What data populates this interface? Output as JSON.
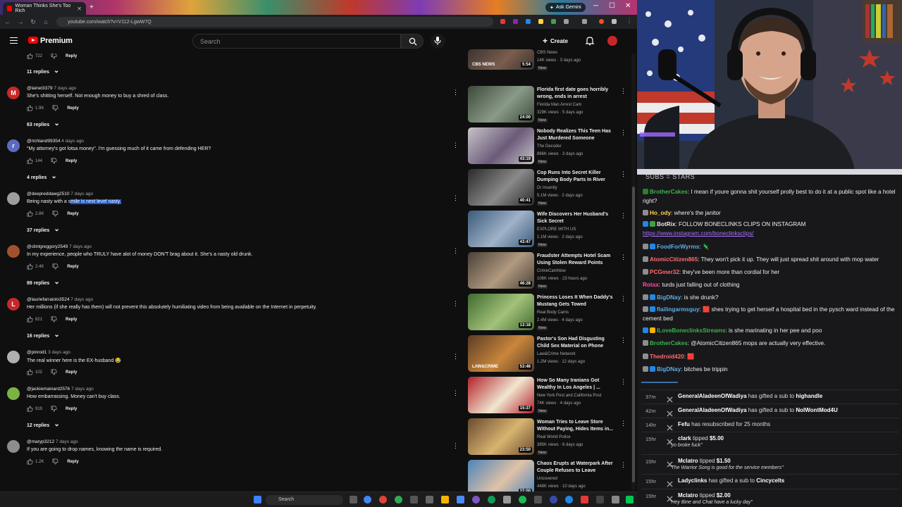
{
  "browser": {
    "tab_title": "Woman Thinks She's Too Rich",
    "gemini_label": "Ask Gemini",
    "url": "youtube.com/watch?v=V112-LgwW7Q"
  },
  "youtube": {
    "brand": "Premium",
    "search_placeholder": "Search",
    "create_label": "Create"
  },
  "comments": [
    {
      "type": "actions",
      "likes": "722"
    },
    {
      "type": "replies",
      "label": "11 replies"
    },
    {
      "type": "comment",
      "initial": "M",
      "avatar_color": "#c62828",
      "author": "@lainet3379",
      "time": "7 days ago",
      "text": "She's shitting herself. Not enough money to buy a shred of class.",
      "likes": "1.9K"
    },
    {
      "type": "replies",
      "label": "63 replies"
    },
    {
      "type": "comment",
      "initial": "r",
      "avatar_color": "#5c6bc0",
      "author": "@richland99354",
      "time": "4 days ago",
      "text": "\"My attorney's got lotsa money\".  I'm guessing much of it came from defending HER?",
      "likes": "144"
    },
    {
      "type": "replies",
      "label": "4 replies"
    },
    {
      "type": "comment",
      "initial": "",
      "avatar_color": "#9e9e9e",
      "author": "@deepreddawg2510",
      "time": "7 days ago",
      "text_plain": "Being nasty with a s",
      "text_highlight": "mile is next level nasty.",
      "likes": "2.8K"
    },
    {
      "type": "replies",
      "label": "37 replies"
    },
    {
      "type": "comment",
      "initial": "",
      "avatar_color": "#a1522d",
      "author": "@clintgreggory2549",
      "time": "7 days ago",
      "text": "In my experience,  people who TRULY have alot of money DON'T brag about it. She's a nasty old drunk.",
      "likes": "2.4K"
    },
    {
      "type": "replies",
      "label": "89 replies"
    },
    {
      "type": "comment",
      "initial": "L",
      "avatar_color": "#c62828",
      "author": "@lauriefarraiolo3524",
      "time": "7 days ago",
      "text": "Her millions (if she really has them) will not prevent this absolutely humiliating video from being available on the Internet in perpetuity.",
      "likes": "821"
    },
    {
      "type": "replies",
      "label": "16 replies"
    },
    {
      "type": "comment",
      "initial": "",
      "avatar_color": "#b0b0b0",
      "author": "@pinrod1",
      "time": "3 days ago",
      "text": "The real winner here is the EX-husband 😂",
      "likes": "102"
    },
    {
      "type": "comment",
      "initial": "",
      "avatar_color": "#7cb342",
      "author": "@jackiemainard2576",
      "time": "7 days ago",
      "text": "How embarrassing.  Money can't buy class.",
      "likes": "919"
    },
    {
      "type": "replies",
      "label": "12 replies"
    },
    {
      "type": "comment",
      "initial": "",
      "avatar_color": "#8d8d8d",
      "author": "@maryp3212",
      "time": "7 days ago",
      "text": "If you are going to drop names, knowing the name is required.",
      "likes": "1.2K"
    }
  ],
  "reply_label": "Reply",
  "related": [
    {
      "title": "",
      "channel": "CBS News",
      "views": "14K views · 3 days ago",
      "duration": "5:54",
      "badge": "New",
      "thumb": "#3b3330",
      "thumb2": "#7a5d4d",
      "thumb_label": "CBS NEWS"
    },
    {
      "title": "Florida first date goes horribly wrong, ends in arrest",
      "channel": "Florida Man Arrest Cam",
      "views": "329K views · 5 days ago",
      "duration": "24:00",
      "badge": "New",
      "thumb": "#3d4a3a",
      "thumb2": "#8a9a88",
      "thumb_label": ""
    },
    {
      "title": "Nobody Realizes This Teen Has Just Murdered Someone",
      "channel": "The Decoder",
      "views": "866K views · 3 days ago",
      "duration": "43:19",
      "badge": "New",
      "thumb": "#c7c4c8",
      "thumb2": "#6b5a7a",
      "thumb_label": ""
    },
    {
      "title": "Cop Runs Into Secret Killer Dumping Body Parts In River",
      "channel": "Dr Insanity",
      "views": "5.1M views · 2 days ago",
      "duration": "40:41",
      "badge": "New",
      "thumb": "#2a2a2a",
      "thumb2": "#8a8a8a",
      "thumb_label": ""
    },
    {
      "title": "Wife Discovers Her Husband's Sick Secret",
      "channel": "EXPLORE WITH US",
      "views": "1.1M views · 2 days ago",
      "duration": "43:47",
      "badge": "New",
      "thumb": "#3b5a7a",
      "thumb2": "#9fb2c8",
      "thumb_label": ""
    },
    {
      "title": "Fraudster Attempts Hotel Scam Using Stolen Reward Points",
      "channel": "CrimeCamNow",
      "views": "106K views · 23 hours ago",
      "duration": "46:28",
      "badge": "New",
      "thumb": "#4a4036",
      "thumb2": "#b09a80",
      "thumb_label": ""
    },
    {
      "title": "Princess Loses It When Daddy's Mustang Gets Towed",
      "channel": "Real Body Cams",
      "views": "2.4M views · 4 days ago",
      "duration": "13:18",
      "badge": "New",
      "thumb": "#3f6a2e",
      "thumb2": "#a3c27a",
      "thumb_label": ""
    },
    {
      "title": "Pastor's Son Had Disgusting Child Sex Material on Phone",
      "channel": "Law&Crime Network",
      "views": "1.2M views · 12 days ago",
      "duration": "53:46",
      "badge": "",
      "thumb": "#5a3c25",
      "thumb2": "#c9863c",
      "thumb_label": "LAW&CRIME"
    },
    {
      "title": "How So Many Iranians Got Wealthy In Los Angeles | ...",
      "channel": "New York Post and California Post",
      "views": "74K views · 4 days ago",
      "duration": "15:37",
      "badge": "New",
      "thumb": "#b3202a",
      "thumb2": "#f0e6d0",
      "thumb_label": ""
    },
    {
      "title": "Woman Tries to Leave Store Without Paying, Hides Items in...",
      "channel": "Real World Police",
      "views": "385K views · 6 days ago",
      "duration": "23:50",
      "badge": "New",
      "thumb": "#6a4a30",
      "thumb2": "#d8b470",
      "thumb_label": ""
    },
    {
      "title": "Chaos Erupts at Waterpark After Couple Refuses to Leave",
      "channel": "Uncovered",
      "views": "448K views · 10 days ago",
      "duration": "22:00",
      "badge": "",
      "thumb": "#4c84b8",
      "thumb2": "#e0c2a8",
      "thumb_label": ""
    }
  ],
  "taskbar": {
    "search_label": "Search"
  },
  "chat": {
    "header": "SUBS = STARS",
    "messages": [
      {
        "user": "BrotherCakes",
        "color": "#3bb34a",
        "text": "I mean if youre gonna shit yourself prolly best to do it at a public spot like a hotel right?",
        "badges": [
          "#2e7d32"
        ]
      },
      {
        "user": "Ho_ody",
        "color": "#ffd54f",
        "text": "where's the janitor",
        "badges": [
          "#8e8e8e"
        ]
      },
      {
        "user": "BotRix",
        "color": "#e8e8e8",
        "text": "FOLLOW BONECLINKS CLIPS ON INSTAGRAM",
        "link": "https://www.instagram.com/boneclinksclips/",
        "badges": [
          "#1e88e5",
          "#43a047"
        ]
      },
      {
        "user": "FoodForWyrms",
        "color": "#5dade2",
        "text": "🦎",
        "badges": [
          "#8e8e8e",
          "#1e88e5"
        ]
      },
      {
        "user": "AtomicCitizen865",
        "color": "#ff6b6b",
        "text": "They won't pick it up. They will just spread shit around with mop water",
        "badges": [
          "#8e8e8e"
        ]
      },
      {
        "user": "PCGmer32",
        "color": "#ff6b6b",
        "text": "they've been more than cordial for her",
        "badges": [
          "#8e8e8e"
        ]
      },
      {
        "user": "Rotax",
        "color": "#ff4fa3",
        "text": "turds just falling out of clothing",
        "badges": []
      },
      {
        "user": "BigDNay",
        "color": "#5dade2",
        "text": "is she drunk?",
        "badges": [
          "#8e8e8e",
          "#1e88e5"
        ]
      },
      {
        "user": "flailingarmsguy",
        "color": "#5dade2",
        "text": "🟥 shes trying to get herself a hospital bed in the pysch ward instead of the cement bed",
        "badges": [
          "#8e8e8e",
          "#1e88e5"
        ]
      },
      {
        "user": "ILoveBoneclinksStreams",
        "color": "#3bb34a",
        "text": "is she marinating in her pee and poo",
        "badges": [
          "#1e88e5",
          "#ffb300"
        ]
      },
      {
        "user": "BrotherCakes",
        "color": "#3bb34a",
        "text": "@AtomicCitizen865 mops are actually very effective.",
        "badges": [
          "#8e8e8e"
        ]
      },
      {
        "user": "Thedroid420",
        "color": "#ff6b6b",
        "text": "🟥",
        "badges": [
          "#8e8e8e"
        ]
      },
      {
        "user": "BigDNay",
        "color": "#5dade2",
        "text": "bitches be trippin",
        "badges": [
          "#8e8e8e",
          "#1e88e5"
        ]
      }
    ],
    "events": [
      {
        "time": "37m",
        "user": "GeneralAladeenOfWadiya",
        "action": "has gifted a sub to",
        "target": "highandle",
        "message": ""
      },
      {
        "time": "42m",
        "user": "GeneralAladeenOfWadiya",
        "action": "has gifted a sub to",
        "target": "NoIWontMod4U",
        "message": ""
      },
      {
        "time": "14hr",
        "user": "Fefu",
        "action": "has resubscribed for 25 months",
        "target": "",
        "message": ""
      },
      {
        "time": "15hr",
        "user": "clark",
        "action": "tipped",
        "target": "$5.00",
        "message": "\"yo broke fuck\""
      },
      {
        "time": "15hr",
        "user": "Mclatro",
        "action": "tipped",
        "target": "$1.50",
        "message": "\"The Warrior Song is good for the service members\""
      },
      {
        "time": "15hr",
        "user": "Ladyclinks",
        "action": "has gifted a sub to",
        "target": "Cincycelts",
        "message": ""
      },
      {
        "time": "15hr",
        "user": "Mclatro",
        "action": "tipped",
        "target": "$2.00",
        "message": "\"Hey Bine and Chat have a lucky day\""
      }
    ]
  }
}
